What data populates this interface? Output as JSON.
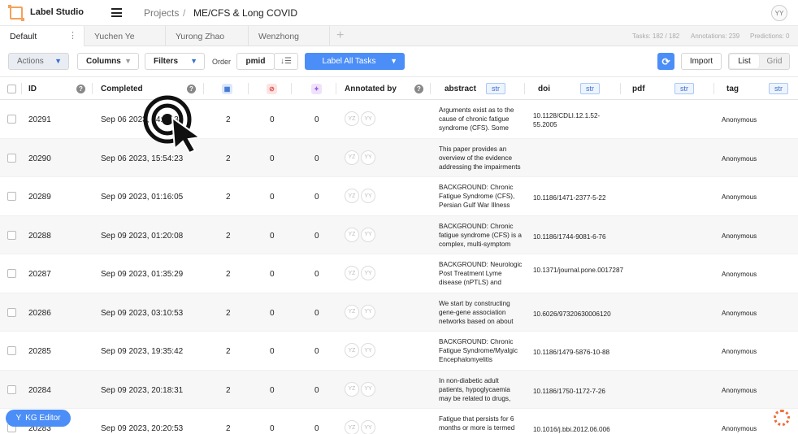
{
  "app": {
    "name": "Label Studio",
    "user_initials": "YY"
  },
  "breadcrumb": {
    "projects": "Projects",
    "separator": "/",
    "project": "ME/CFS & Long COVID"
  },
  "tabs": [
    {
      "label": "Default",
      "active": true
    },
    {
      "label": "Yuchen Ye"
    },
    {
      "label": "Yurong Zhao"
    },
    {
      "label": "Wenzhong"
    }
  ],
  "tab_menu_glyph": "⋮",
  "add_tab_glyph": "+",
  "stats": {
    "tasks": "Tasks: 182 / 182",
    "annotations": "Annotations: 239",
    "predictions": "Predictions: 0"
  },
  "toolbar": {
    "actions": "Actions",
    "columns": "Columns",
    "filters": "Filters",
    "order_label": "Order",
    "order_field": "pmid",
    "sort_glyph": "↓☰",
    "label_all": "Label All Tasks",
    "refresh_glyph": "⟳",
    "import": "Import",
    "view_list": "List",
    "view_grid": "Grid"
  },
  "columns": {
    "id": "ID",
    "completed": "Completed",
    "annotated_by": "Annotated by",
    "abstract": "abstract",
    "doi": "doi",
    "pdf": "pdf",
    "tag": "tag",
    "type_badge": "str",
    "help_glyph": "?"
  },
  "rows": [
    {
      "id": "20291",
      "completed": "Sep 06 2023, 14:54:38",
      "n1": "2",
      "n2": "0",
      "n3": "0",
      "av1": "YZ",
      "av2": "YY",
      "abstract": "Arguments exist as to the cause of chronic fatigue syndrome (CFS). Some",
      "doi": "10.1128/CDLI.12.1.52-55.2005",
      "tag": "Anonymous"
    },
    {
      "id": "20290",
      "completed": "Sep 06 2023, 15:54:23",
      "n1": "2",
      "n2": "0",
      "n3": "0",
      "av1": "YZ",
      "av2": "YY",
      "abstract": "This paper provides an overview of the evidence addressing the impairments",
      "doi": "",
      "tag": "Anonymous"
    },
    {
      "id": "20289",
      "completed": "Sep 09 2023, 01:16:05",
      "n1": "2",
      "n2": "0",
      "n3": "0",
      "av1": "YZ",
      "av2": "YY",
      "abstract": "BACKGROUND: Chronic Fatigue Syndrome (CFS), Persian Gulf War Illness",
      "doi": "10.1186/1471-2377-5-22",
      "tag": "Anonymous"
    },
    {
      "id": "20288",
      "completed": "Sep 09 2023, 01:20:08",
      "n1": "2",
      "n2": "0",
      "n3": "0",
      "av1": "YZ",
      "av2": "YY",
      "abstract": "BACKGROUND: Chronic fatigue syndrome (CFS) is a complex, multi-symptom",
      "doi": "10.1186/1744-9081-6-76",
      "tag": "Anonymous"
    },
    {
      "id": "20287",
      "completed": "Sep 09 2023, 01:35:29",
      "n1": "2",
      "n2": "0",
      "n3": "0",
      "av1": "YZ",
      "av2": "YY",
      "abstract": "BACKGROUND: Neurologic Post Treatment Lyme disease (nPTLS) and",
      "doi": "10.1371/journal.pone.0017287",
      "tag": "Anonymous"
    },
    {
      "id": "20286",
      "completed": "Sep 09 2023, 03:10:53",
      "n1": "2",
      "n2": "0",
      "n3": "0",
      "av1": "YZ",
      "av2": "YY",
      "abstract": "We start by constructing gene-gene association networks based on about",
      "doi": "10.6026/97320630006120",
      "tag": "Anonymous"
    },
    {
      "id": "20285",
      "completed": "Sep 09 2023, 19:35:42",
      "n1": "2",
      "n2": "0",
      "n3": "0",
      "av1": "YZ",
      "av2": "YY",
      "abstract": "BACKGROUND: Chronic Fatigue Syndrome/Myalgic Encephalomyelitis",
      "doi": "10.1186/1479-5876-10-88",
      "tag": "Anonymous"
    },
    {
      "id": "20284",
      "completed": "Sep 09 2023, 20:18:31",
      "n1": "2",
      "n2": "0",
      "n3": "0",
      "av1": "YZ",
      "av2": "YY",
      "abstract": "In non-diabetic adult patients, hypoglycaemia may be related to drugs,",
      "doi": "10.1186/1750-1172-7-26",
      "tag": "Anonymous"
    },
    {
      "id": "20283",
      "completed": "Sep 09 2023, 20:20:53",
      "n1": "2",
      "n2": "0",
      "n3": "0",
      "av1": "YZ",
      "av2": "YY",
      "abstract": "Fatigue that persists for 6 months or more is termed",
      "doi": "10.1016/j.bbi.2012.06.006",
      "tag": "Anonymous"
    }
  ],
  "kg_editor": "KG Editor",
  "colors": {
    "accent": "#4c8ef7",
    "brand": "#f5a15a",
    "spinner": "#ee6d3a"
  }
}
